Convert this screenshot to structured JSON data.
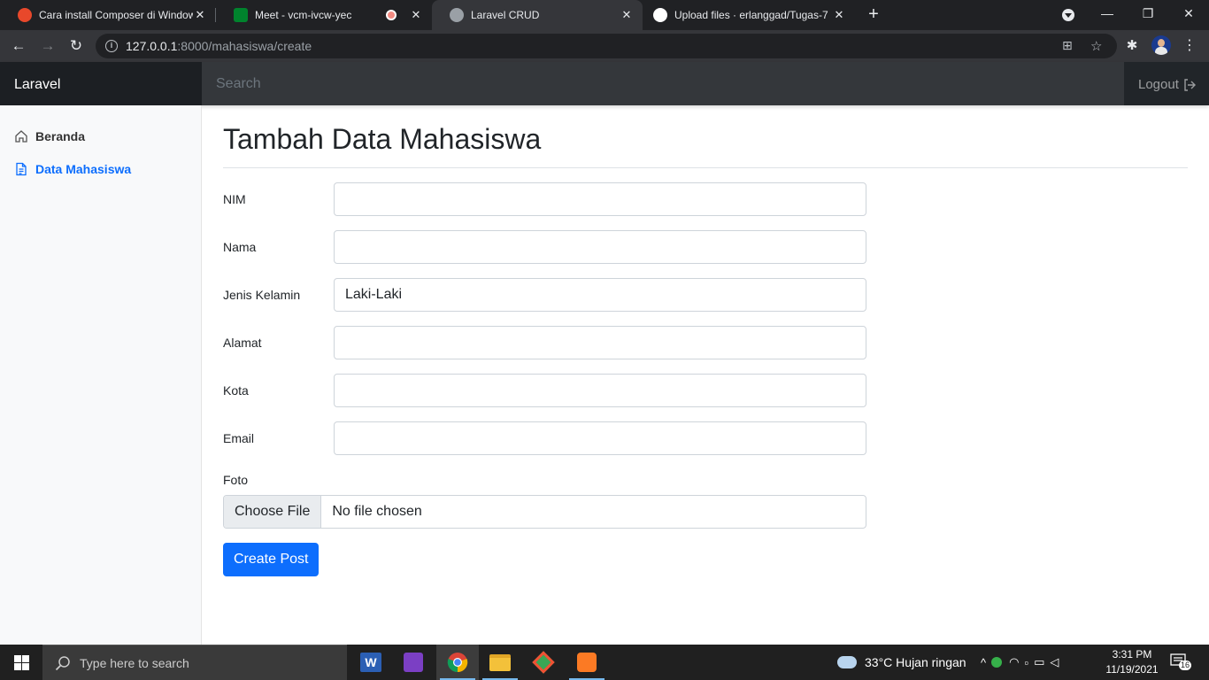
{
  "browser": {
    "tabs": [
      {
        "title": "Cara install Composer di Window",
        "close": "✕"
      },
      {
        "title": "Meet - vcm-ivcw-yec",
        "close": "✕"
      },
      {
        "title": "Laravel CRUD",
        "close": "✕",
        "active": true
      },
      {
        "title": "Upload files · erlanggad/Tugas-7",
        "close": "✕"
      }
    ],
    "new_tab": "+",
    "url_host": "127.0.0.1",
    "url_rest": ":8000/mahasiswa/create"
  },
  "navbar": {
    "brand": "Laravel",
    "search_placeholder": "Search",
    "logout": "Logout"
  },
  "sidebar": {
    "items": [
      {
        "label": "Beranda",
        "icon": "home-icon"
      },
      {
        "label": "Data Mahasiswa",
        "icon": "file-icon",
        "active": true
      }
    ]
  },
  "form": {
    "title": "Tambah Data Mahasiswa",
    "fields": [
      {
        "label": "NIM",
        "value": ""
      },
      {
        "label": "Nama",
        "value": ""
      },
      {
        "label": "Jenis Kelamin",
        "value": "Laki-Laki"
      },
      {
        "label": "Alamat",
        "value": ""
      },
      {
        "label": "Kota",
        "value": ""
      },
      {
        "label": "Email",
        "value": ""
      }
    ],
    "foto_label": "Foto",
    "choose_file": "Choose File",
    "no_file": "No file chosen",
    "submit": "Create Post"
  },
  "taskbar": {
    "search_placeholder": "Type here to search",
    "weather": "33°C  Hujan ringan",
    "time": "3:31 PM",
    "date": "11/19/2021",
    "notifications": "16"
  },
  "colors": {
    "primary": "#0d6efd",
    "navbar": "#212529",
    "sidebar": "#f8f9fa"
  }
}
